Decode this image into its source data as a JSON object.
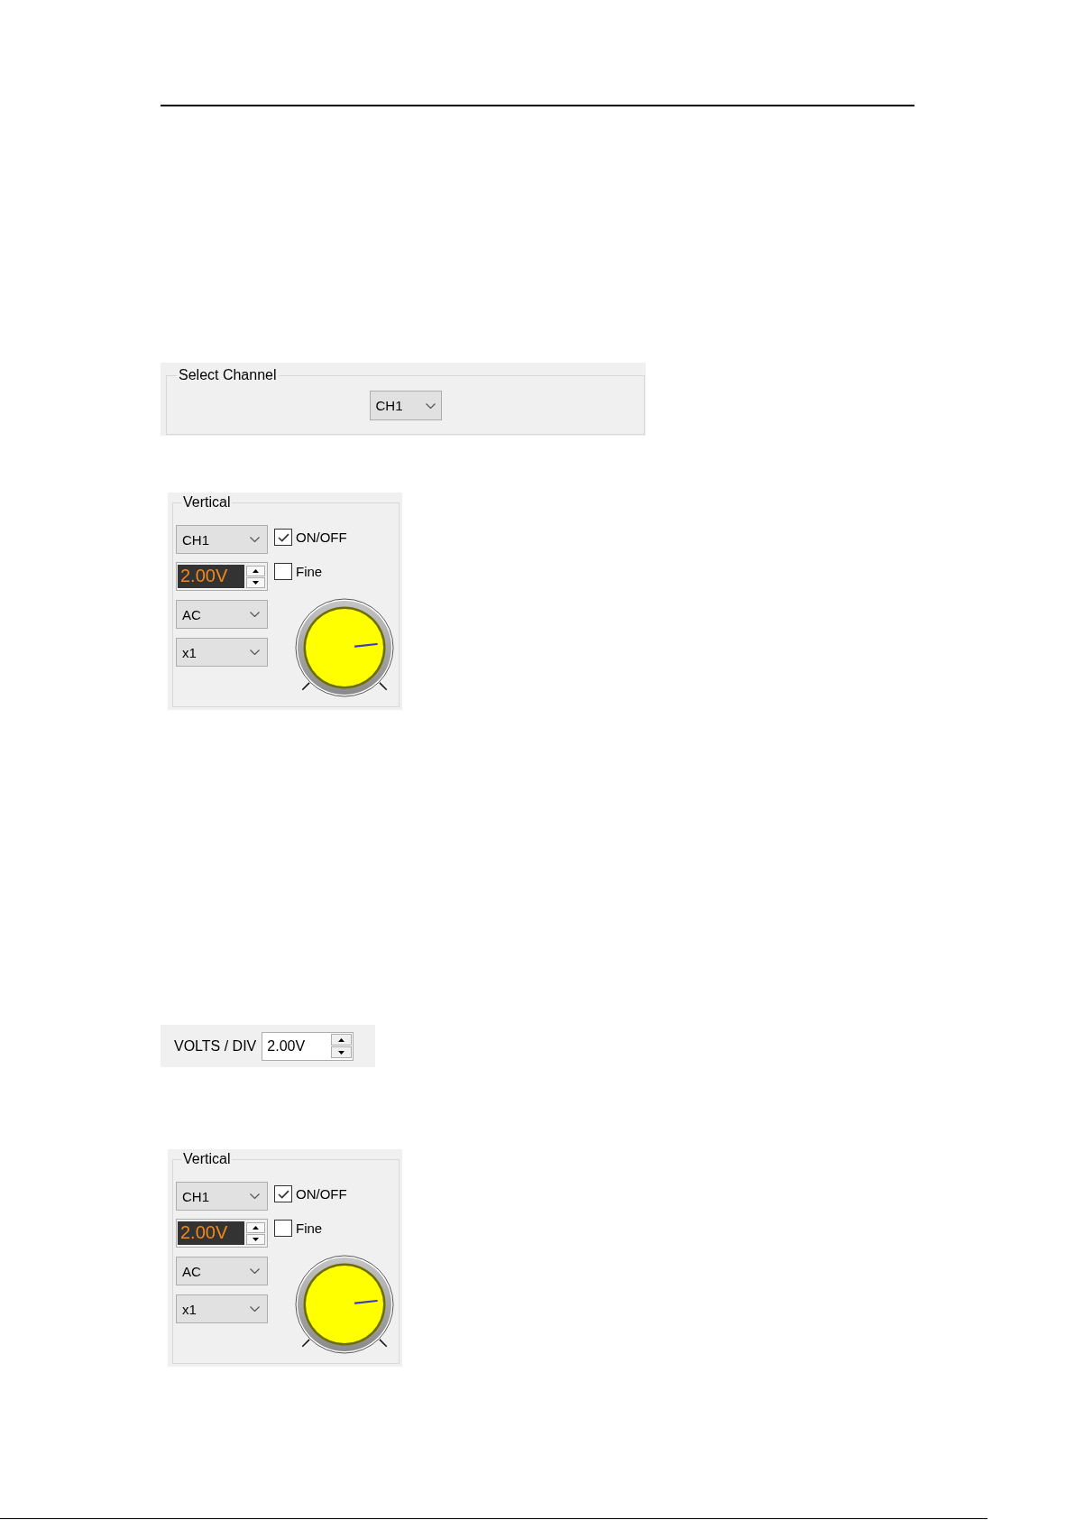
{
  "sections": [
    {
      "kind": "channel_select",
      "title": "Select Channel",
      "channel": "CH1"
    },
    {
      "kind": "vertical",
      "title": "Vertical",
      "channel": "CH1",
      "volts_div": "2.00V",
      "coupling": "AC",
      "probe": "x1",
      "checkboxes": [
        {
          "label": "ON/OFF",
          "checked": true
        },
        {
          "label": "Fine",
          "checked": false
        }
      ],
      "knob": {
        "level": 0.81
      }
    },
    {
      "kind": "volts_div",
      "label": "VOLTS / DIV",
      "value": "2.00V"
    },
    {
      "kind": "vertical",
      "title": "Vertical",
      "channel": "CH1",
      "volts_div": "2.00V",
      "coupling": "AC",
      "probe": "x1",
      "checkboxes": [
        {
          "label": "ON/OFF",
          "checked": true
        },
        {
          "label": "Fine",
          "checked": false
        }
      ],
      "knob": {
        "level": 0.81
      }
    }
  ]
}
